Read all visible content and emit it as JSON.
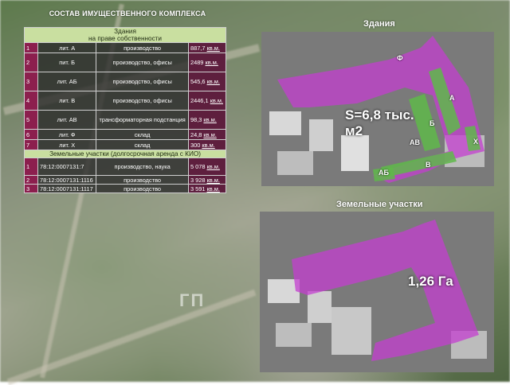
{
  "heading": "СОСТАВ ИМУЩЕСТВЕННОГО КОМПЛЕКСА",
  "buildings": {
    "header_line1": "Здания",
    "header_line2": "на праве собственности",
    "rows": [
      {
        "n": "1",
        "lit": "лит. А",
        "use": "производство",
        "area_value": "887,7",
        "area_unit": "кв.м."
      },
      {
        "n": "2",
        "lit": "пит. Б",
        "use": "производство, офисы",
        "area_value": "2489",
        "area_unit": "кв.м."
      },
      {
        "n": "3",
        "lit": "лит. АБ",
        "use": "производство, офисы",
        "area_value": "545,6",
        "area_unit": "кв.м."
      },
      {
        "n": "4",
        "lit": "лит. В",
        "use": "производство, офисы",
        "area_value": "2446,1",
        "area_unit": "кв.м."
      },
      {
        "n": "5",
        "lit": "лит. АВ",
        "use": "трансформаторная подстанция",
        "area_value": "98,3",
        "area_unit": "кв.м."
      },
      {
        "n": "6",
        "lit": "лит. Ф",
        "use": "склад",
        "area_value": "24,8",
        "area_unit": "кв.м."
      },
      {
        "n": "7",
        "lit": "лит. Х",
        "use": "склад",
        "area_value": "300",
        "area_unit": "кв.м."
      }
    ]
  },
  "land": {
    "header": "Земельные участки (долгосрочная аренда с КИО)",
    "rows": [
      {
        "n": "1",
        "cadastral": "78:12:0007131:7",
        "use": "производство, наука",
        "area_value": "5 078",
        "area_unit": "кв.м."
      },
      {
        "n": "2",
        "cadastral": "78:12:0007131:1116",
        "use": "производство",
        "area_value": "3 928",
        "area_unit": "кв.м."
      },
      {
        "n": "3",
        "cadastral": "78:12:0007131:1117",
        "use": "производство",
        "area_value": "3 591",
        "area_unit": "кв.м."
      }
    ]
  },
  "map_buildings": {
    "title": "Здания",
    "total": "S=6,8 тыс. м2",
    "labels": [
      "Ф",
      "А",
      "Б",
      "АВ",
      "АБ",
      "В",
      "Х"
    ]
  },
  "map_land": {
    "title": "Земельные участки",
    "total": "1,26 Га"
  },
  "colors": {
    "accent_magenta": "#c43fd0",
    "green_building": "#5fb84a",
    "header_green": "#c9dfa0"
  }
}
